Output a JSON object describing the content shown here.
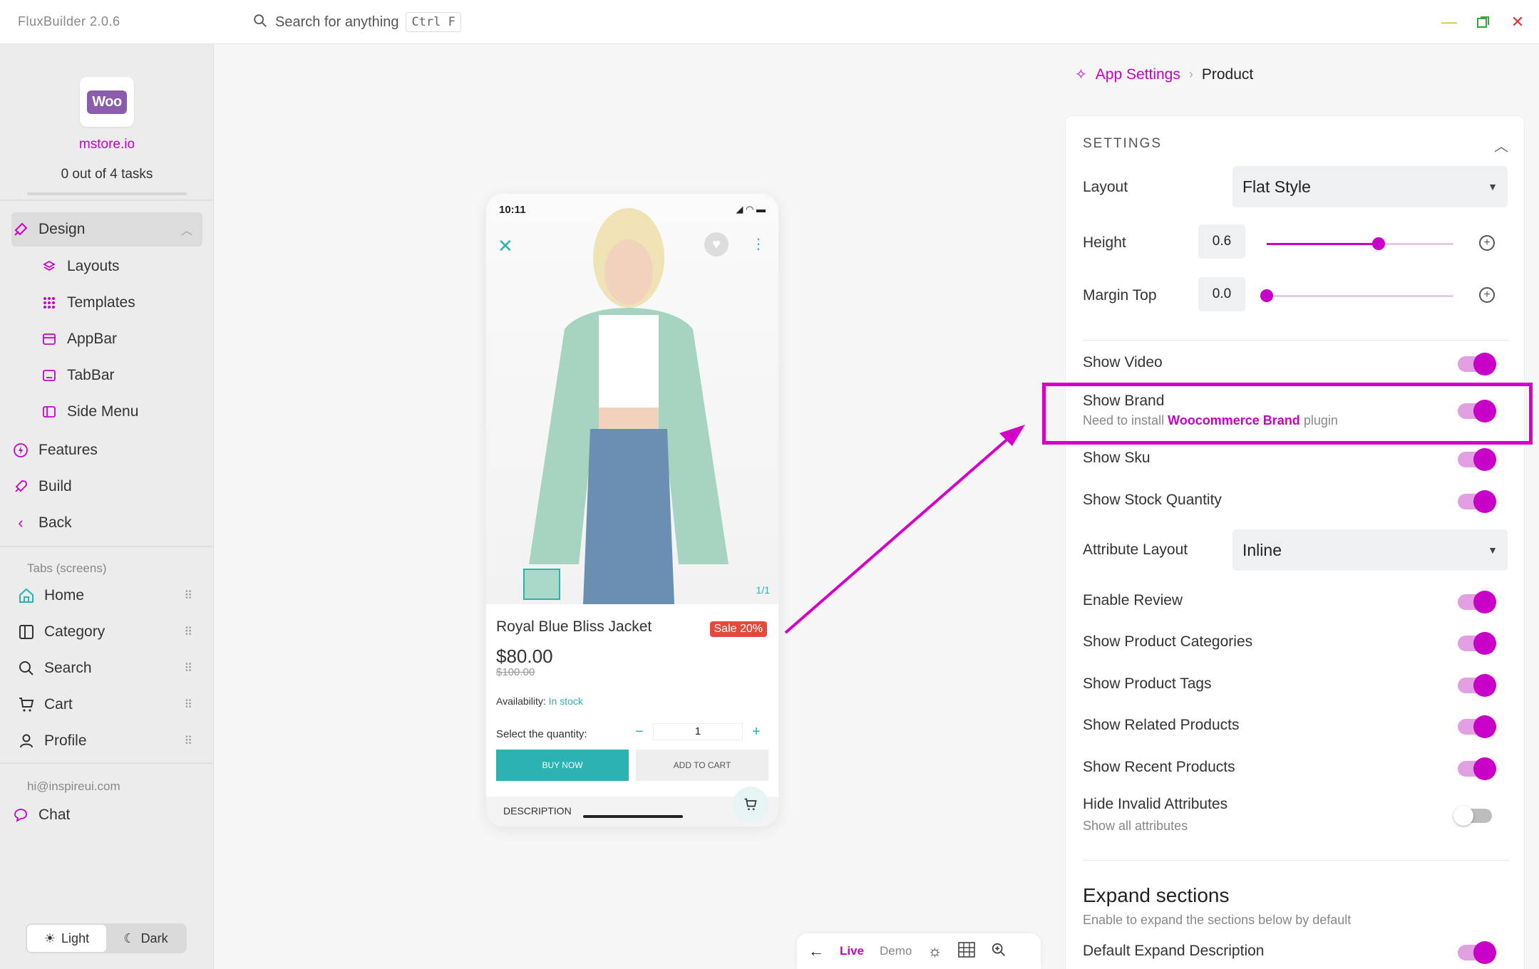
{
  "titlebar": {
    "app_title": "FluxBuilder 2.0.6",
    "search_placeholder": "Search for anything",
    "search_shortcut": "Ctrl F"
  },
  "sidebar": {
    "store_name": "mstore.io",
    "tasks": "0 out of 4 tasks",
    "logo_text": "Woo",
    "design": "Design",
    "design_items": [
      "Layouts",
      "Templates",
      "AppBar",
      "TabBar",
      "Side Menu"
    ],
    "features": "Features",
    "build": "Build",
    "back": "Back",
    "tabs_label": "Tabs (screens)",
    "tabs": [
      "Home",
      "Category",
      "Search",
      "Cart",
      "Profile"
    ],
    "email": "hi@inspireui.com",
    "chat": "Chat",
    "theme_light": "Light",
    "theme_dark": "Dark"
  },
  "phone": {
    "time": "10:11",
    "image_count": "1/1",
    "product_title": "Royal Blue Bliss Jacket",
    "sale_badge": "Sale 20%",
    "price": "$80.00",
    "old_price": "$100.00",
    "availability_label": "Availability:",
    "availability_value": "In stock",
    "qty_label": "Select the quantity:",
    "qty_value": "1",
    "buy_now": "BUY NOW",
    "add_to_cart": "ADD TO CART",
    "description": "DESCRIPTION"
  },
  "preview_bar": {
    "live": "Live",
    "demo": "Demo"
  },
  "breadcrumb": {
    "root": "App Settings",
    "current": "Product"
  },
  "settings": {
    "title": "SETTINGS",
    "layout_label": "Layout",
    "layout_value": "Flat Style",
    "height_label": "Height",
    "height_value": "0.6",
    "height_fraction": 0.6,
    "margin_top_label": "Margin Top",
    "margin_top_value": "0.0",
    "margin_top_fraction": 0.0,
    "show_video": "Show Video",
    "show_brand": "Show Brand",
    "brand_note_pre": "Need to install",
    "brand_note_link": "Woocommerce Brand",
    "brand_note_post": "plugin",
    "show_sku": "Show Sku",
    "show_stock": "Show Stock Quantity",
    "attribute_layout_label": "Attribute Layout",
    "attribute_layout_value": "Inline",
    "enable_review": "Enable Review",
    "show_categories": "Show Product Categories",
    "show_tags": "Show Product Tags",
    "show_related": "Show Related Products",
    "show_recent": "Show Recent Products",
    "hide_invalid": "Hide Invalid Attributes",
    "hide_invalid_sub": "Show all attributes",
    "expand_title": "Expand sections",
    "expand_sub": "Enable to expand the sections below by default",
    "default_expand_desc": "Default Expand Description"
  },
  "colors": {
    "accent": "#c800c8",
    "teal": "#2ab3b0",
    "sale": "#e24a3b"
  }
}
